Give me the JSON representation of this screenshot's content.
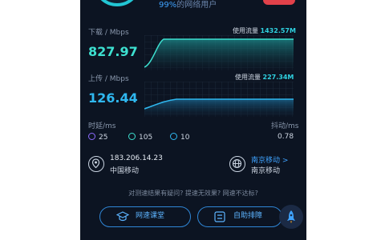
{
  "header": {
    "percent": "99%",
    "percent_suffix": "的网络用户"
  },
  "download": {
    "label": "下载 / Mbps",
    "value": "827.97",
    "usage_label": "使用流量",
    "usage_value": "1432.57M"
  },
  "upload": {
    "label": "上传 / Mbps",
    "value": "126.44",
    "usage_label": "使用流量",
    "usage_value": "227.34M"
  },
  "latency": {
    "label": "时延/ms",
    "values": [
      "25",
      "105",
      "10"
    ],
    "jitter_label": "抖动/ms",
    "jitter_value": "0.78"
  },
  "client": {
    "ip": "183.206.14.23",
    "isp": "中国移动"
  },
  "server": {
    "link": "南京移动 >",
    "isp": "南京移动"
  },
  "faq_text": "对测速结果有疑问? 提速无效果? 网速不达标?",
  "buttons": {
    "course": "网速课堂",
    "troubleshoot": "自助排障"
  },
  "colors": {
    "accent_cyan": "#22c6d4",
    "accent_blue": "#3fa3ff",
    "background": "#0c1422",
    "download_value": "#3de0d0",
    "upload_value": "#2fb8f0"
  }
}
